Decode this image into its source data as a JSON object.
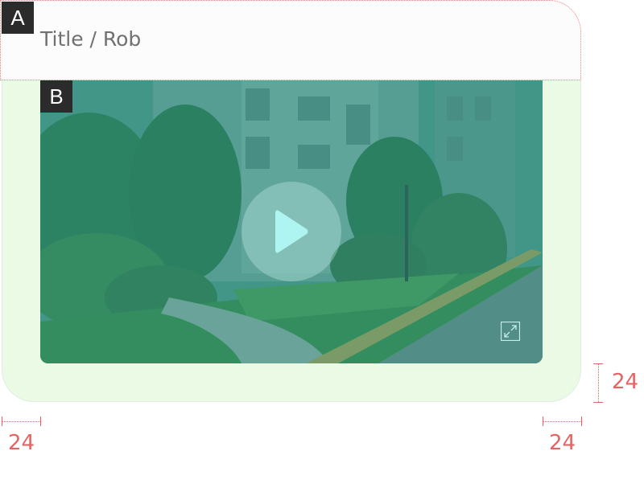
{
  "labels": {
    "region_a": "A",
    "region_b": "B"
  },
  "header": {
    "title": "Title / Rob"
  },
  "spacing": {
    "left": "24",
    "right": "24",
    "bottom": "24"
  },
  "icons": {
    "play": "play-icon",
    "fullscreen": "expand-icon"
  },
  "colors": {
    "card_background": "#ebfae5",
    "annotation": "#e66363",
    "label_background": "#2b2b2b"
  }
}
